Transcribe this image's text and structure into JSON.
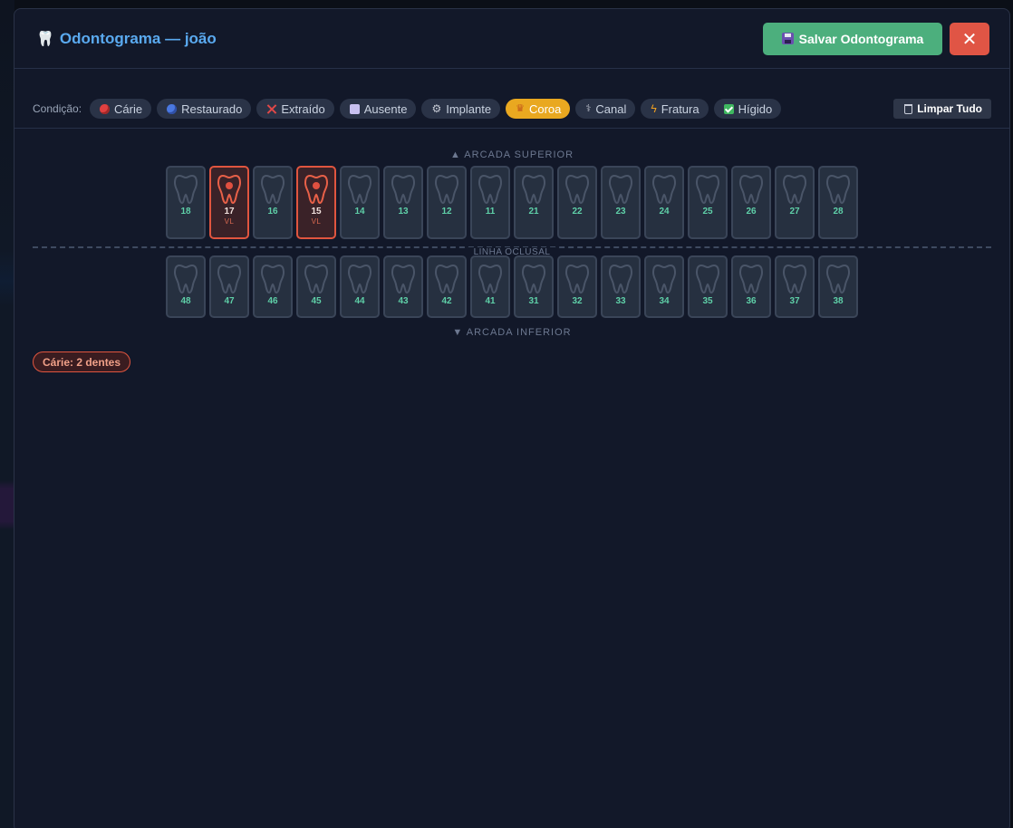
{
  "modal": {
    "title": "Odontograma — joão",
    "save_label": "Salvar Odontograma",
    "close_label": "✕"
  },
  "toolbar": {
    "label": "Condição:",
    "conditions": [
      {
        "key": "carie",
        "label": "Cárie",
        "icon": "red-circle-icon",
        "active": false
      },
      {
        "key": "restaurado",
        "label": "Restaurado",
        "icon": "blue-circle-icon",
        "active": false
      },
      {
        "key": "extraido",
        "label": "Extraído",
        "icon": "cross-mark-icon",
        "active": false
      },
      {
        "key": "ausente",
        "label": "Ausente",
        "icon": "square-icon",
        "active": false
      },
      {
        "key": "implante",
        "label": "Implante",
        "icon": "gear-icon",
        "active": false
      },
      {
        "key": "coroa",
        "label": "Coroa",
        "icon": "crown-icon",
        "active": true
      },
      {
        "key": "canal",
        "label": "Canal",
        "icon": "syringe-icon",
        "active": false
      },
      {
        "key": "fratura",
        "label": "Fratura",
        "icon": "lightning-icon",
        "active": false
      },
      {
        "key": "higido",
        "label": "Hígido",
        "icon": "check-box-icon",
        "active": false
      }
    ],
    "clear_label": "Limpar Tudo"
  },
  "arches": {
    "upper_label": "▲ ARCADA SUPERIOR",
    "occlusal_label": "LINHA OCLUSAL",
    "lower_label": "▼ ARCADA INFERIOR"
  },
  "upper_teeth": [
    {
      "num": "18",
      "condition": "",
      "faces": ""
    },
    {
      "num": "17",
      "condition": "carie",
      "faces": "VL"
    },
    {
      "num": "16",
      "condition": "",
      "faces": ""
    },
    {
      "num": "15",
      "condition": "carie",
      "faces": "VL"
    },
    {
      "num": "14",
      "condition": "",
      "faces": ""
    },
    {
      "num": "13",
      "condition": "",
      "faces": ""
    },
    {
      "num": "12",
      "condition": "",
      "faces": ""
    },
    {
      "num": "11",
      "condition": "",
      "faces": ""
    },
    {
      "num": "21",
      "condition": "",
      "faces": ""
    },
    {
      "num": "22",
      "condition": "",
      "faces": ""
    },
    {
      "num": "23",
      "condition": "",
      "faces": ""
    },
    {
      "num": "24",
      "condition": "",
      "faces": ""
    },
    {
      "num": "25",
      "condition": "",
      "faces": ""
    },
    {
      "num": "26",
      "condition": "",
      "faces": ""
    },
    {
      "num": "27",
      "condition": "",
      "faces": ""
    },
    {
      "num": "28",
      "condition": "",
      "faces": ""
    }
  ],
  "lower_teeth": [
    {
      "num": "48",
      "condition": "",
      "faces": ""
    },
    {
      "num": "47",
      "condition": "",
      "faces": ""
    },
    {
      "num": "46",
      "condition": "",
      "faces": ""
    },
    {
      "num": "45",
      "condition": "",
      "faces": ""
    },
    {
      "num": "44",
      "condition": "",
      "faces": ""
    },
    {
      "num": "43",
      "condition": "",
      "faces": ""
    },
    {
      "num": "42",
      "condition": "",
      "faces": ""
    },
    {
      "num": "41",
      "condition": "",
      "faces": ""
    },
    {
      "num": "31",
      "condition": "",
      "faces": ""
    },
    {
      "num": "32",
      "condition": "",
      "faces": ""
    },
    {
      "num": "33",
      "condition": "",
      "faces": ""
    },
    {
      "num": "34",
      "condition": "",
      "faces": ""
    },
    {
      "num": "35",
      "condition": "",
      "faces": ""
    },
    {
      "num": "36",
      "condition": "",
      "faces": ""
    },
    {
      "num": "37",
      "condition": "",
      "faces": ""
    },
    {
      "num": "38",
      "condition": "",
      "faces": ""
    }
  ],
  "summary": {
    "text": "Cárie: 2 dentes"
  },
  "colors": {
    "accent_blue": "#5aaaf0",
    "save_green": "#4caf7d",
    "close_red": "#e05545",
    "active_amber": "#e9a820",
    "carie_red": "#e0553f",
    "tooth_number_green": "#5fd0a8"
  }
}
